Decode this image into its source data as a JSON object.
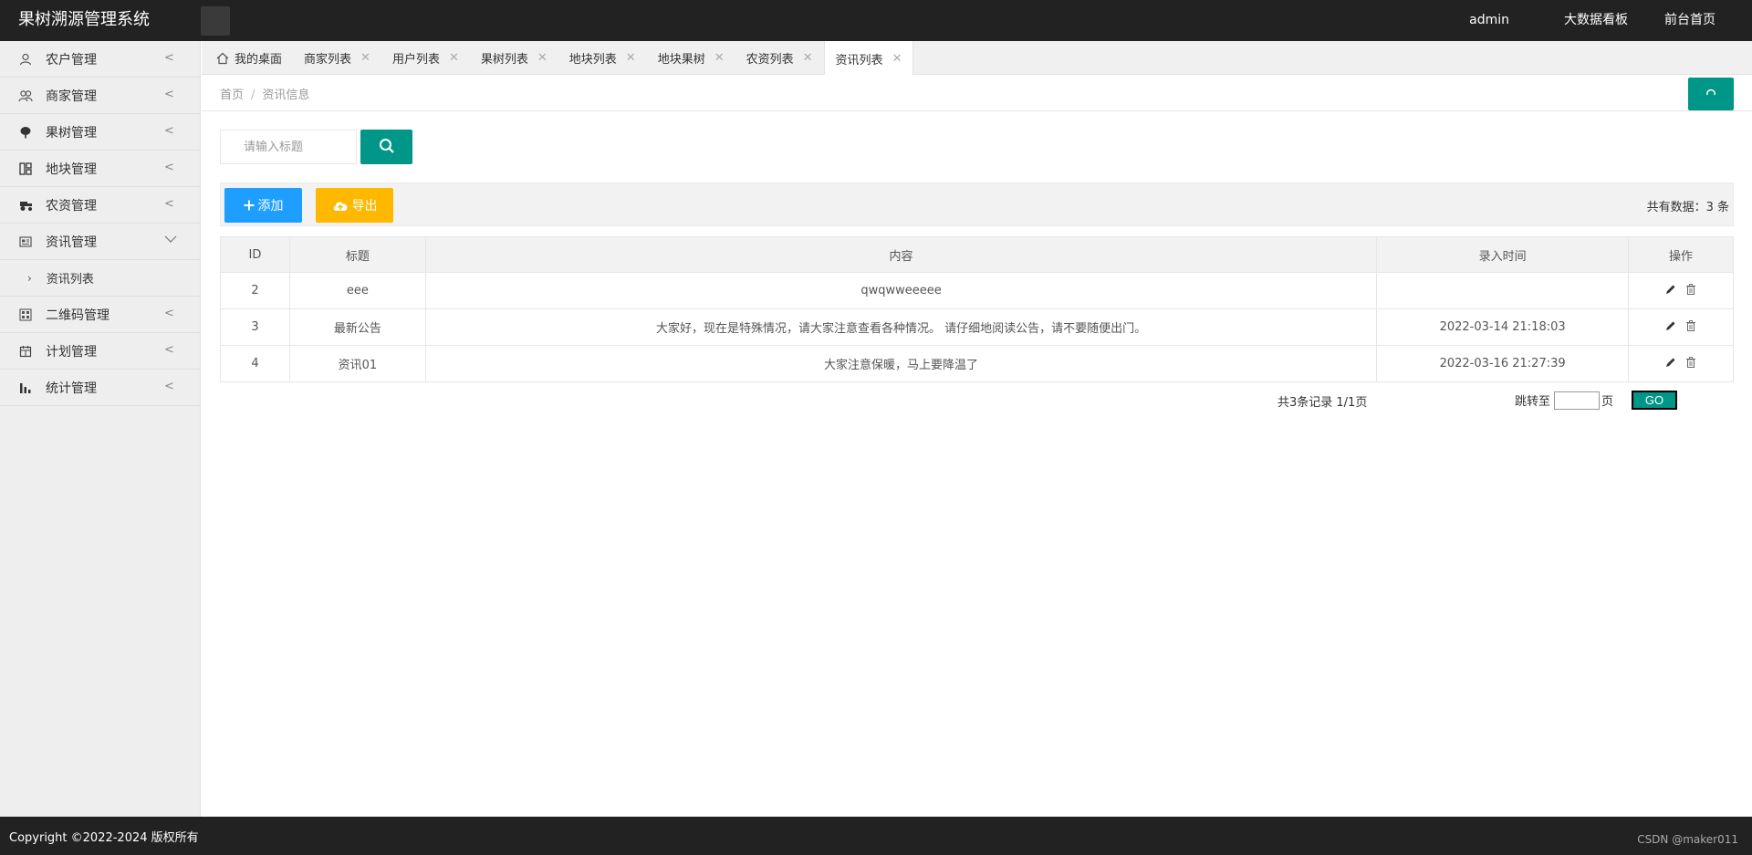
{
  "header": {
    "title": "果树溯源管理系统",
    "nav": [
      "admin",
      "大数据看板",
      "前台首页"
    ]
  },
  "sidebar": {
    "items": [
      {
        "label": "农户管理",
        "icon": "user-icon"
      },
      {
        "label": "商家管理",
        "icon": "users-icon"
      },
      {
        "label": "果树管理",
        "icon": "tree-icon"
      },
      {
        "label": "地块管理",
        "icon": "grid-icon"
      },
      {
        "label": "农资管理",
        "icon": "tractor-icon"
      },
      {
        "label": "资讯管理",
        "icon": "news-icon",
        "expanded": true
      },
      {
        "label": "二维码管理",
        "icon": "qrcode-icon"
      },
      {
        "label": "计划管理",
        "icon": "calendar-icon"
      },
      {
        "label": "统计管理",
        "icon": "bar-chart-icon"
      }
    ],
    "sub_items": [
      {
        "label": "资讯列表"
      }
    ]
  },
  "tabs": [
    {
      "label": "我的桌面",
      "home": true
    },
    {
      "label": "商家列表"
    },
    {
      "label": "用户列表"
    },
    {
      "label": "果树列表"
    },
    {
      "label": "地块列表"
    },
    {
      "label": "地块果树"
    },
    {
      "label": "农资列表"
    },
    {
      "label": "资讯列表",
      "active": true
    }
  ],
  "breadcrumb": {
    "home": "首页",
    "separator": "/",
    "current": "资讯信息"
  },
  "search": {
    "placeholder": "请输入标题"
  },
  "toolbar": {
    "add_label": "添加",
    "export_label": "导出",
    "count_text": "共有数据：3 条"
  },
  "table": {
    "headers": [
      "ID",
      "标题",
      "内容",
      "录入时间",
      "操作"
    ],
    "rows": [
      {
        "id": "2",
        "title": "eee",
        "content": "qwqwweeeee",
        "time": ""
      },
      {
        "id": "3",
        "title": "最新公告",
        "content": "大家好，现在是特殊情况，请大家注意查看各种情况。 请仔细地阅读公告，请不要随便出门。",
        "time": "2022-03-14 21:18:03"
      },
      {
        "id": "4",
        "title": "资讯01",
        "content": "大家注意保暖，马上要降温了",
        "time": "2022-03-16 21:27:39"
      }
    ]
  },
  "pager": {
    "total_text": "共3条记录  1/1页",
    "jump_label": "跳转至",
    "page_unit": "页",
    "go_label": "GO"
  },
  "footer": {
    "copyright": "Copyright ©2022-2024 版权所有",
    "watermark": "CSDN @maker011"
  },
  "colors": {
    "header_bg": "#222222",
    "primary": "#009688",
    "add": "#1e9fff",
    "export": "#ffb800"
  }
}
